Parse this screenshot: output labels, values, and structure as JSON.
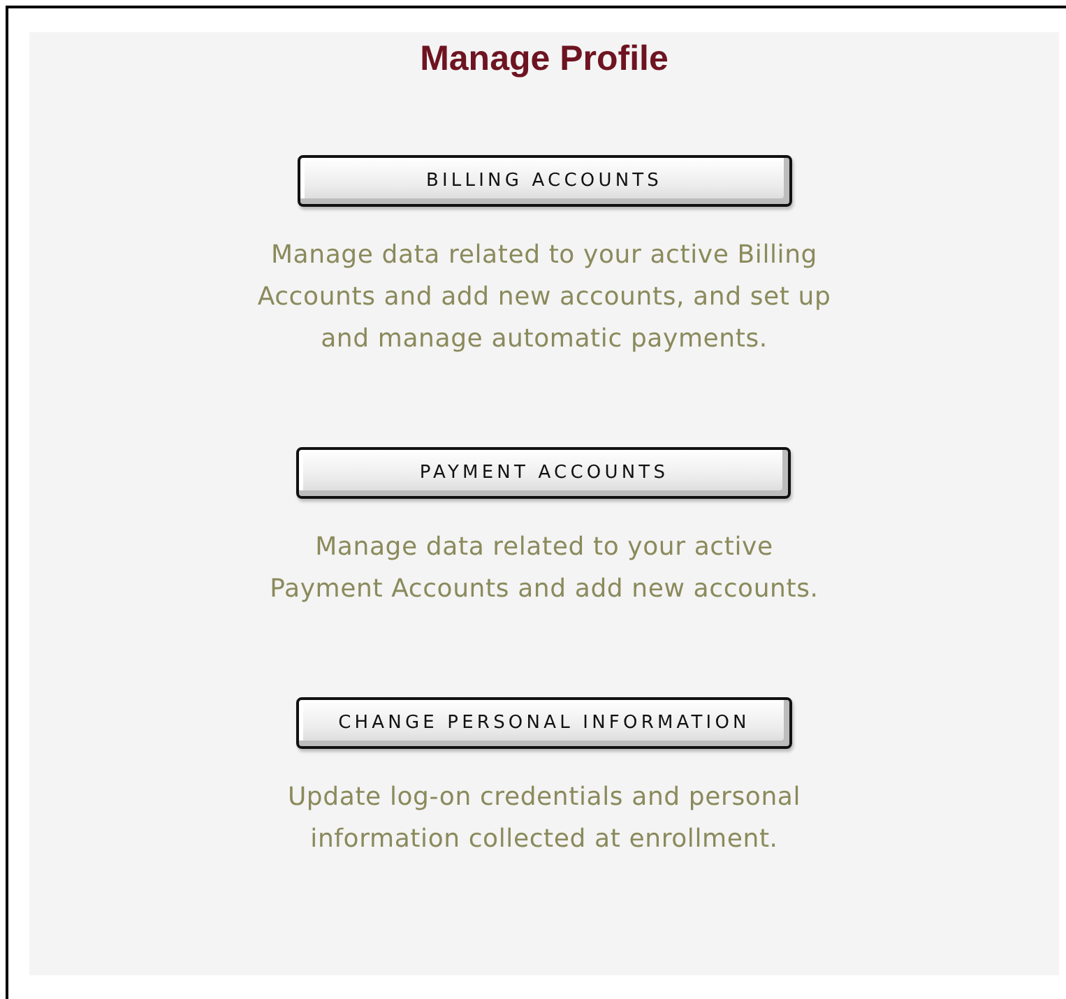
{
  "title": "Manage Profile",
  "sections": [
    {
      "button": "BILLING ACCOUNTS",
      "description_lines": [
        "Manage data related to your active Billing",
        "Accounts and add new accounts, and set up",
        "and manage automatic payments."
      ]
    },
    {
      "button": "PAYMENT ACCOUNTS",
      "description_lines": [
        "Manage data related to your active",
        "Payment Accounts and add new accounts."
      ]
    },
    {
      "button": "CHANGE PERSONAL INFORMATION",
      "description_lines": [
        "Update log-on credentials and personal",
        "information collected at enrollment."
      ]
    }
  ]
}
